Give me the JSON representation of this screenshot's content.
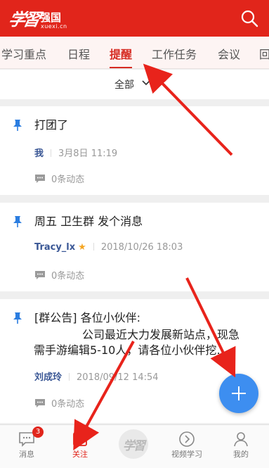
{
  "header": {
    "logo_script": "学習",
    "logo_name": "强国",
    "logo_domain": "xuexi.cn",
    "search_icon": "search-icon",
    "accent_color": "#e1251b"
  },
  "tabs": [
    {
      "label": "学习重点"
    },
    {
      "label": "日程"
    },
    {
      "label": "提醒",
      "active": true
    },
    {
      "label": "工作任务"
    },
    {
      "label": "会议"
    },
    {
      "label": "回"
    }
  ],
  "filter": {
    "label": "全部"
  },
  "reminders": [
    {
      "title": "打团了",
      "author": "我",
      "date": "3月8日  11:19",
      "activity": "0条动态"
    },
    {
      "title": "周五  卫生群  发个消息",
      "author": "Tracy_lx",
      "star": "★",
      "date": "2018/10/26  18:03",
      "activity": "0条动态"
    },
    {
      "title": "[群公告] 各位小伙伴:",
      "body_line1": "公司最近大力发展新站点，现急",
      "body_line2": "需手游编辑5-10人，请各位小伙伴挖…",
      "author": "刘成玲",
      "date": "2018/09/12  14:54",
      "activity": "0条动态"
    }
  ],
  "fab": {
    "icon": "plus-icon",
    "color": "#3d8ef0"
  },
  "bottom_nav": [
    {
      "label": "消息",
      "icon": "message-icon",
      "badge": "3"
    },
    {
      "label": "关注",
      "icon": "follow-icon",
      "active": true
    },
    {
      "label": "",
      "icon": "xuexi-logo-icon",
      "logo_text": "学習"
    },
    {
      "label": "视频学习",
      "icon": "play-icon"
    },
    {
      "label": "我的",
      "icon": "user-icon"
    }
  ]
}
